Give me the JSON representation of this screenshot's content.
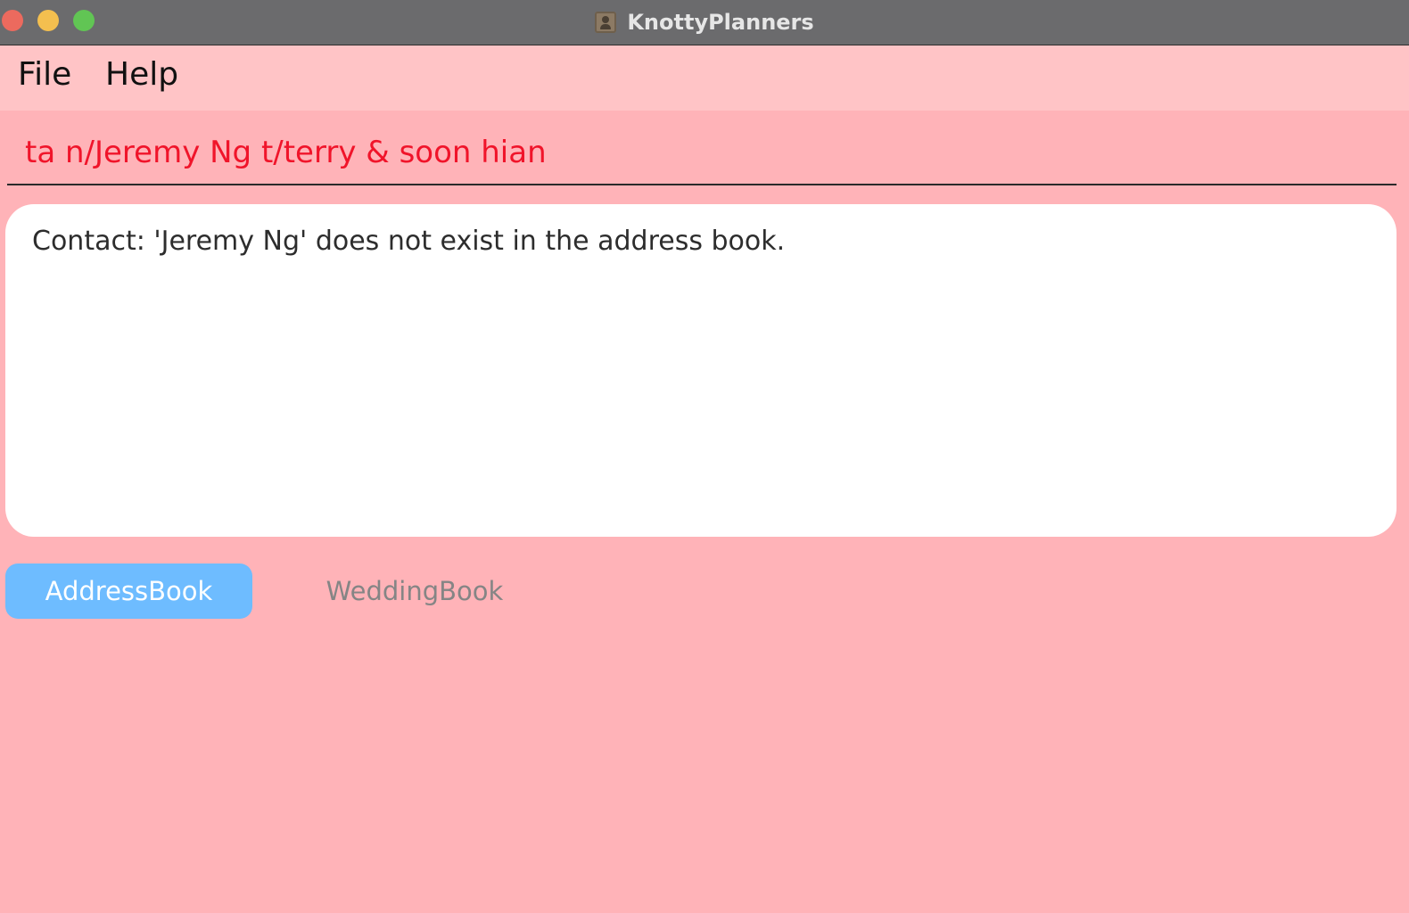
{
  "window": {
    "title": "KnottyPlanners",
    "app_icon": "contacts-icon",
    "controls": [
      "close-icon",
      "minimize-icon",
      "zoom-icon"
    ]
  },
  "menu": {
    "file_label": "File",
    "help_label": "Help"
  },
  "command": {
    "value": "ta n/Jeremy Ng t/terry & soon hian",
    "color": "#f0142a"
  },
  "result": {
    "message": "Contact: 'Jeremy Ng' does not exist in the address book."
  },
  "tabs": [
    {
      "label": "AddressBook",
      "selected": true
    },
    {
      "label": "WeddingBook",
      "selected": false
    }
  ],
  "colors": {
    "background": "#ffb3b8",
    "menubar": "#ffc4c6",
    "selected_tab": "#6ebcff"
  }
}
